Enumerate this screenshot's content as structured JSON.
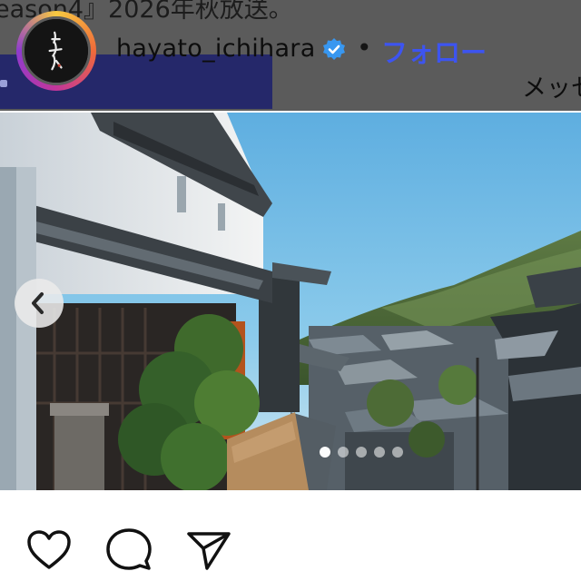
{
  "caption": {
    "overflow_text": "eason4』2026年秋放送。"
  },
  "header": {
    "username": "hayato_ichihara",
    "verified_icon": "verified-badge-icon",
    "separator": "•",
    "follow_label": "フォロー",
    "message_label": "メッセ"
  },
  "avatar": {
    "icon": "calligraphy-logo",
    "ring_colors": [
      "#f7c940",
      "#f06a3a",
      "#c2369a",
      "#8e3bcf"
    ]
  },
  "carousel": {
    "prev_icon": "chevron-left-icon",
    "active_index": 0,
    "dots": [
      {
        "active": true
      },
      {
        "active": false
      },
      {
        "active": false
      },
      {
        "active": false
      },
      {
        "active": false
      }
    ]
  },
  "actions": {
    "like_icon": "heart-icon",
    "comment_icon": "comment-icon",
    "share_icon": "send-icon"
  },
  "colors": {
    "follow": "#3d54f0",
    "verified": "#3897f0",
    "header_dim": "#5b5b5b",
    "banner": "#25286a"
  }
}
